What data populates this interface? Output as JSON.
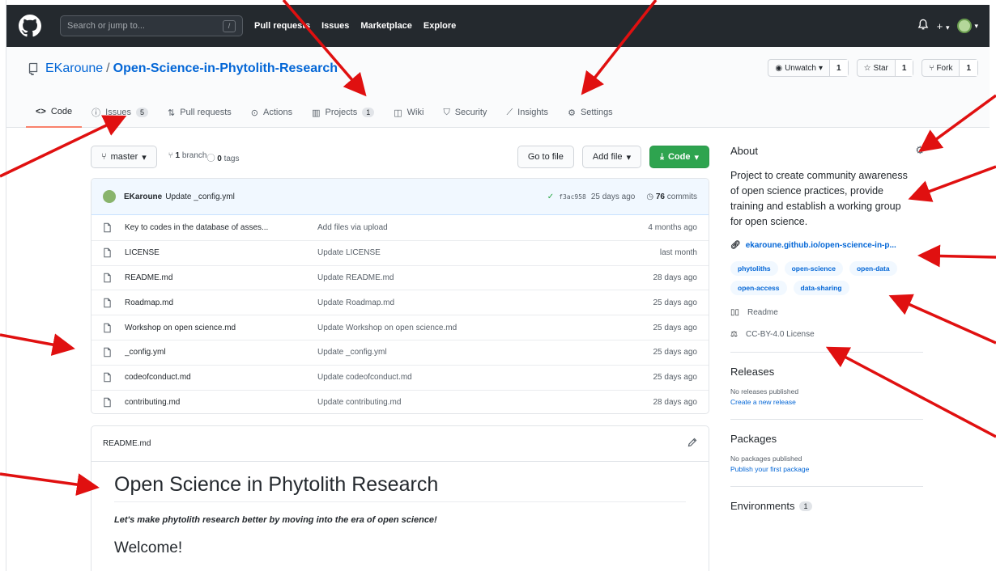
{
  "header": {
    "search_placeholder": "Search or jump to...",
    "slash_key": "/",
    "nav": [
      "Pull requests",
      "Issues",
      "Marketplace",
      "Explore"
    ],
    "plus_label": "+",
    "caret": "▾"
  },
  "repo": {
    "owner": "EKaroune",
    "separator": "/",
    "name": "Open-Science-in-Phytolith-Research",
    "unwatch_label": "Unwatch",
    "unwatch_count": "1",
    "star_label": "Star",
    "star_count": "1",
    "fork_label": "Fork",
    "fork_count": "1"
  },
  "tabs": [
    {
      "label": "Code",
      "icon": "code-icon"
    },
    {
      "label": "Issues",
      "count": "5",
      "icon": "issue-icon"
    },
    {
      "label": "Pull requests",
      "icon": "pull-request-icon"
    },
    {
      "label": "Actions",
      "icon": "actions-icon"
    },
    {
      "label": "Projects",
      "count": "1",
      "icon": "projects-icon"
    },
    {
      "label": "Wiki",
      "icon": "wiki-icon"
    },
    {
      "label": "Security",
      "icon": "shield-icon"
    },
    {
      "label": "Insights",
      "icon": "graph-icon"
    },
    {
      "label": "Settings",
      "icon": "gear-icon"
    }
  ],
  "branchbar": {
    "branch": "master",
    "branches_count": "1",
    "branches_label": "branch",
    "tags_count": "0",
    "tags_label": "tags",
    "go_to_file": "Go to file",
    "add_file": "Add file",
    "code": "Code"
  },
  "commit": {
    "author": "EKaroune",
    "message": "Update _config.yml",
    "sha": "f3ac958",
    "age": "25 days ago",
    "commits_count": "76",
    "commits_label": "commits"
  },
  "files": [
    {
      "name": "Key to codes in the database of asses...",
      "message": "Add files via upload",
      "age": "4 months ago"
    },
    {
      "name": "LICENSE",
      "message": "Update LICENSE",
      "age": "last month"
    },
    {
      "name": "README.md",
      "message": "Update README.md",
      "age": "28 days ago"
    },
    {
      "name": "Roadmap.md",
      "message": "Update Roadmap.md",
      "age": "25 days ago"
    },
    {
      "name": "Workshop on open science.md",
      "message": "Update Workshop on open science.md",
      "age": "25 days ago"
    },
    {
      "name": "_config.yml",
      "message": "Update _config.yml",
      "age": "25 days ago"
    },
    {
      "name": "codeofconduct.md",
      "message": "Update codeofconduct.md",
      "age": "25 days ago"
    },
    {
      "name": "contributing.md",
      "message": "Update contributing.md",
      "age": "28 days ago"
    }
  ],
  "readme": {
    "filename": "README.md",
    "h1": "Open Science in Phytolith Research",
    "tagline": "Let's make phytolith research better by moving into the era of open science!",
    "h2": "Welcome!"
  },
  "about": {
    "title": "About",
    "description": "Project to create community awareness of open science practices, provide training and establish a working group for open science.",
    "link": "ekaroune.github.io/open-science-in-p...",
    "topics": [
      "phytoliths",
      "open-science",
      "open-data",
      "open-access",
      "data-sharing"
    ],
    "readme_label": "Readme",
    "license_label": "CC-BY-4.0 License"
  },
  "releases": {
    "title": "Releases",
    "empty": "No releases published",
    "action": "Create a new release"
  },
  "packages": {
    "title": "Packages",
    "empty": "No packages published",
    "action": "Publish your first package"
  },
  "environments": {
    "title": "Environments",
    "count": "1"
  },
  "colors": {
    "header_bg": "#24292e",
    "accent_link": "#0366d6",
    "green_button": "#2ea44f",
    "active_tab_underline": "#f9826c",
    "annotation_arrow": "#e01010"
  }
}
